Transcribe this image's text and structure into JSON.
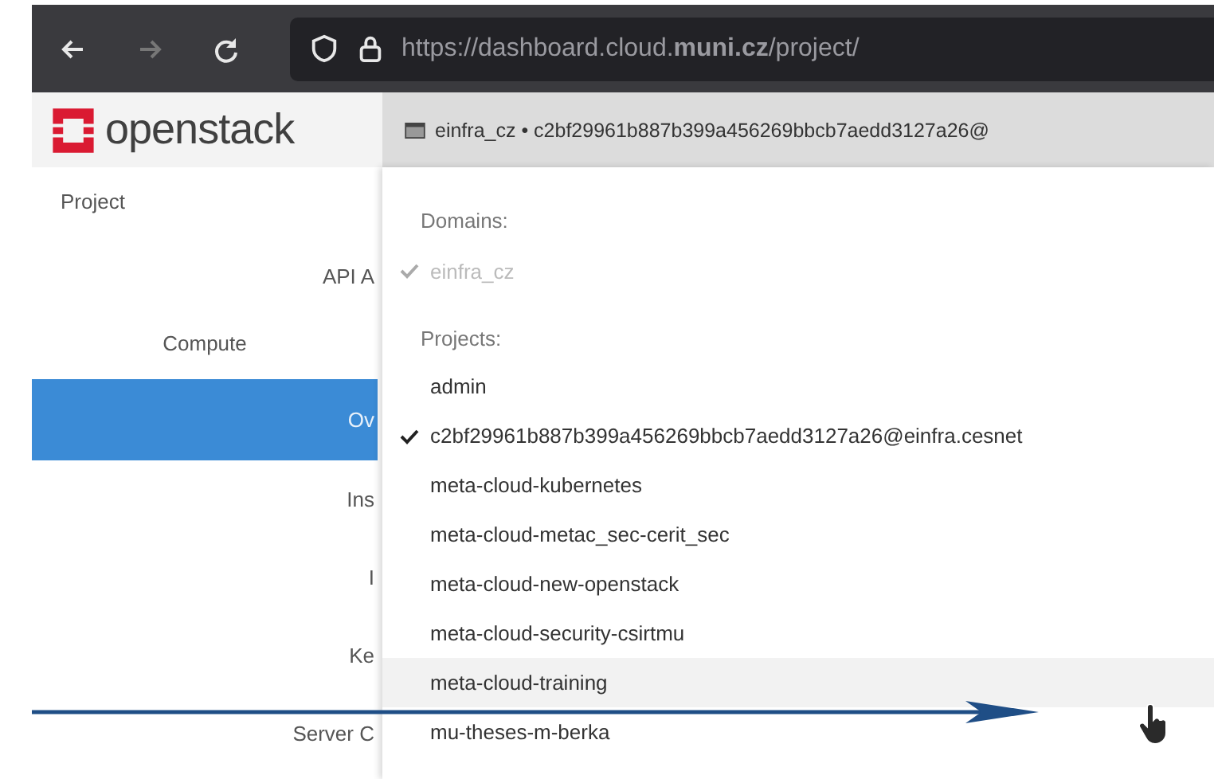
{
  "browser": {
    "url": "https://dashboard.cloud.**muni.cz**/project/",
    "forward_disabled": true
  },
  "header": {
    "logo": "openstack",
    "context": "einfra_cz • c2bf29961b887b399a456269bbcb7aedd3127a26@"
  },
  "sidebar": {
    "items": [
      {
        "label": "Project",
        "children": [
          {
            "label": "API A",
            "selected": false
          },
          {
            "label": "Compute",
            "children": [
              {
                "label": "Ov",
                "selected": true
              },
              {
                "label": "Ins",
                "selected": false
              },
              {
                "label": "I",
                "selected": false
              },
              {
                "label": "Ke",
                "selected": false
              },
              {
                "label": "Server C",
                "selected": false
              }
            ]
          }
        ]
      }
    ]
  },
  "dropdown": {
    "sections": [
      {
        "label": "Domains:",
        "items": [
          {
            "label": "einfra_cz",
            "checked": true,
            "disabled": true,
            "hovered": false
          }
        ]
      },
      {
        "label": "Projects:",
        "items": [
          {
            "label": "admin",
            "checked": false,
            "disabled": false,
            "hovered": false
          },
          {
            "label": "c2bf29961b887b399a456269bbcb7aedd3127a26@einfra.cesnet",
            "checked": true,
            "disabled": false,
            "hovered": false
          },
          {
            "label": "meta-cloud-kubernetes",
            "checked": false,
            "disabled": false,
            "hovered": false
          },
          {
            "label": "meta-cloud-metac_sec-cerit_sec",
            "checked": false,
            "disabled": false,
            "hovered": false
          },
          {
            "label": "meta-cloud-new-openstack",
            "checked": false,
            "disabled": false,
            "hovered": false
          },
          {
            "label": "meta-cloud-security-csirtmu",
            "checked": false,
            "disabled": false,
            "hovered": false
          },
          {
            "label": "meta-cloud-training",
            "checked": false,
            "disabled": false,
            "hovered": true
          },
          {
            "label": "mu-theses-m-berka",
            "checked": false,
            "disabled": false,
            "hovered": false
          }
        ]
      }
    ]
  }
}
